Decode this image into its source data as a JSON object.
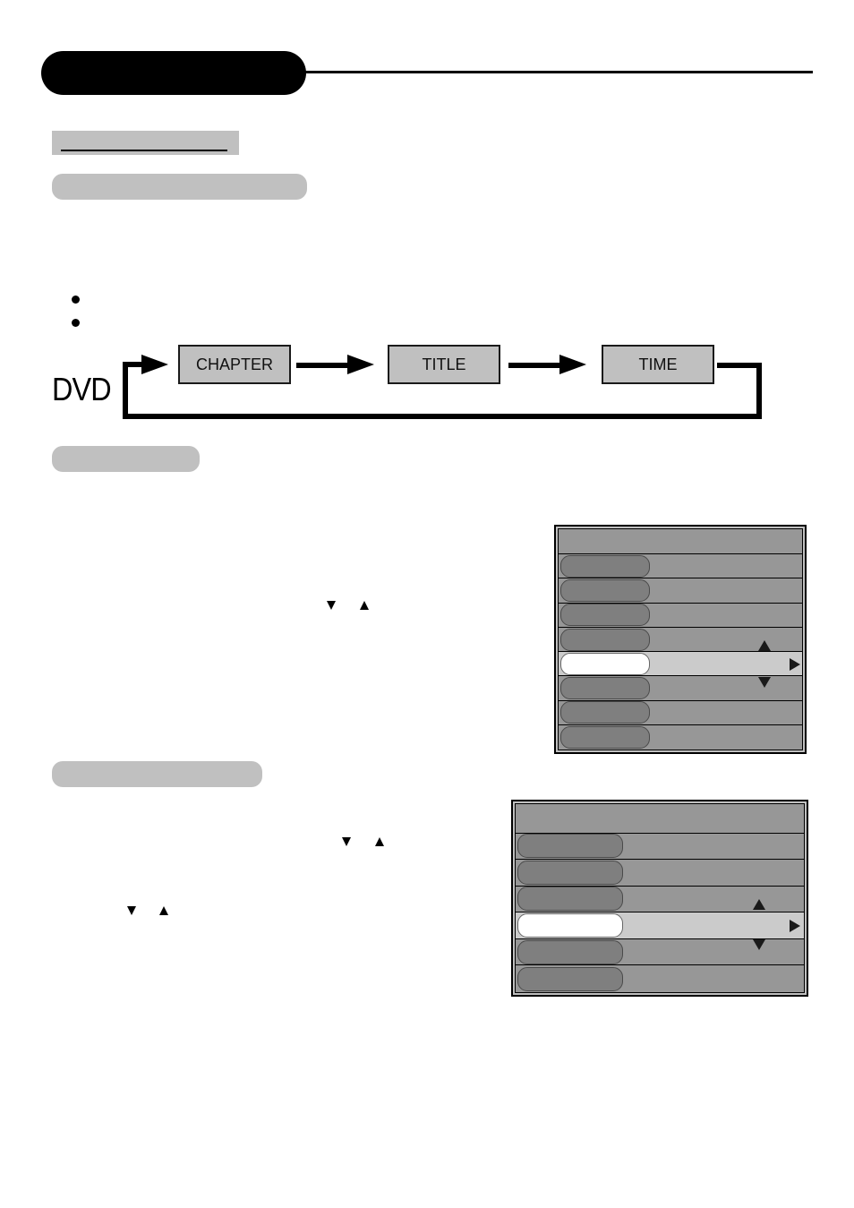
{
  "header": {
    "chapter_title": "",
    "section_tag": ""
  },
  "sections": [
    {
      "title": "",
      "body": ""
    },
    {
      "title": "",
      "body": ""
    },
    {
      "title": "",
      "body": ""
    }
  ],
  "bullets": [
    "",
    ""
  ],
  "flow_diagram": {
    "source_label": "DVD",
    "steps": [
      "CHAPTER",
      "TITLE",
      "TIME"
    ],
    "loops_back": true
  },
  "inline_keys": {
    "down_icon": "down-arrow-key",
    "up_icon": "up-arrow-key"
  },
  "osd_menu_1": {
    "header": "",
    "selected_index": 4,
    "rows": [
      {
        "label": "",
        "value": ""
      },
      {
        "label": "",
        "value": ""
      },
      {
        "label": "",
        "value": ""
      },
      {
        "label": "",
        "value": ""
      },
      {
        "label": "",
        "value": ""
      },
      {
        "label": "",
        "value": ""
      },
      {
        "label": "",
        "value": ""
      },
      {
        "label": "",
        "value": ""
      }
    ]
  },
  "osd_menu_2": {
    "header": "",
    "selected_index": 3,
    "rows": [
      {
        "label": "",
        "value": ""
      },
      {
        "label": "",
        "value": ""
      },
      {
        "label": "",
        "value": ""
      },
      {
        "label": "",
        "value": ""
      },
      {
        "label": "",
        "value": ""
      },
      {
        "label": "",
        "value": ""
      }
    ]
  },
  "colors": {
    "pill_gray": "#c0c0c0",
    "menu_bg": "#979797",
    "row_pill": "#7f7f7f",
    "selected_row": "#cbcbcb",
    "selected_pill": "#ffffff"
  }
}
